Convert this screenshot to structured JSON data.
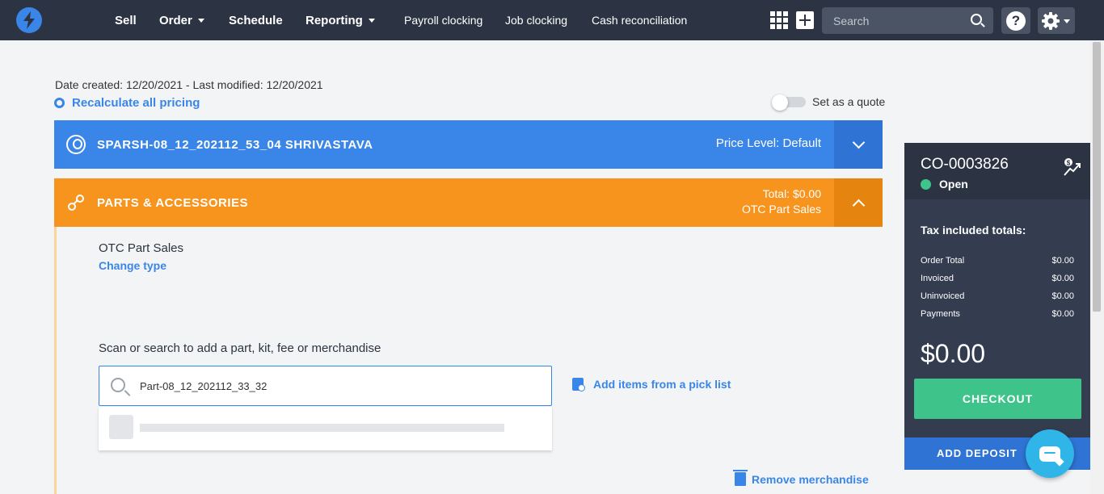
{
  "nav": {
    "items": [
      {
        "label": "Sell",
        "dropdown": false
      },
      {
        "label": "Order",
        "dropdown": true
      },
      {
        "label": "Schedule",
        "dropdown": false
      },
      {
        "label": "Reporting",
        "dropdown": true
      },
      {
        "label": "Payroll clocking",
        "dropdown": false
      },
      {
        "label": "Job clocking",
        "dropdown": false
      },
      {
        "label": "Cash reconciliation",
        "dropdown": false
      }
    ],
    "search_placeholder": "Search",
    "help_label": "?",
    "icons": [
      "logo-bolt-icon",
      "apps-grid-icon",
      "plus-icon",
      "search-icon",
      "help-icon",
      "gear-icon"
    ]
  },
  "page": {
    "date_line": "Date created: 12/20/2021 - Last modified: 12/20/2021",
    "recalc_label": "Recalculate all pricing",
    "quote_label": "Set as a quote",
    "quote_enabled": false
  },
  "customer": {
    "name": "SPARSH-08_12_202112_53_04 SHRIVASTAVA",
    "price_level": "Price Level: Default"
  },
  "parts": {
    "title": "PARTS & ACCESSORIES",
    "total": "Total: $0.00",
    "type": "OTC Part Sales",
    "section_title": "OTC Part Sales",
    "change_type": "Change type",
    "scan_label": "Scan or search to add a part, kit, fee or merchandise",
    "search_value": "Part-08_12_202112_33_32",
    "picklist_label": "Add items from a pick list",
    "remove_label": "Remove merchandise"
  },
  "order": {
    "id": "CO-0003826",
    "status": "Open",
    "status_color": "#3ec48b",
    "tax_title": "Tax included totals:",
    "totals": [
      {
        "label": "Order Total",
        "value": "$0.00"
      },
      {
        "label": "Invoiced",
        "value": "$0.00"
      },
      {
        "label": "Uninvoiced",
        "value": "$0.00"
      },
      {
        "label": "Payments",
        "value": "$0.00"
      }
    ],
    "grand_total": "$0.00",
    "checkout_label": "CHECKOUT",
    "deposit_label": "ADD DEPOSIT"
  },
  "colors": {
    "nav_bg": "#2c3444",
    "accent_blue": "#3a86e8",
    "parts_orange": "#f7941d",
    "checkout_green": "#3ec48b",
    "chat_cyan": "#2fb5e8"
  }
}
